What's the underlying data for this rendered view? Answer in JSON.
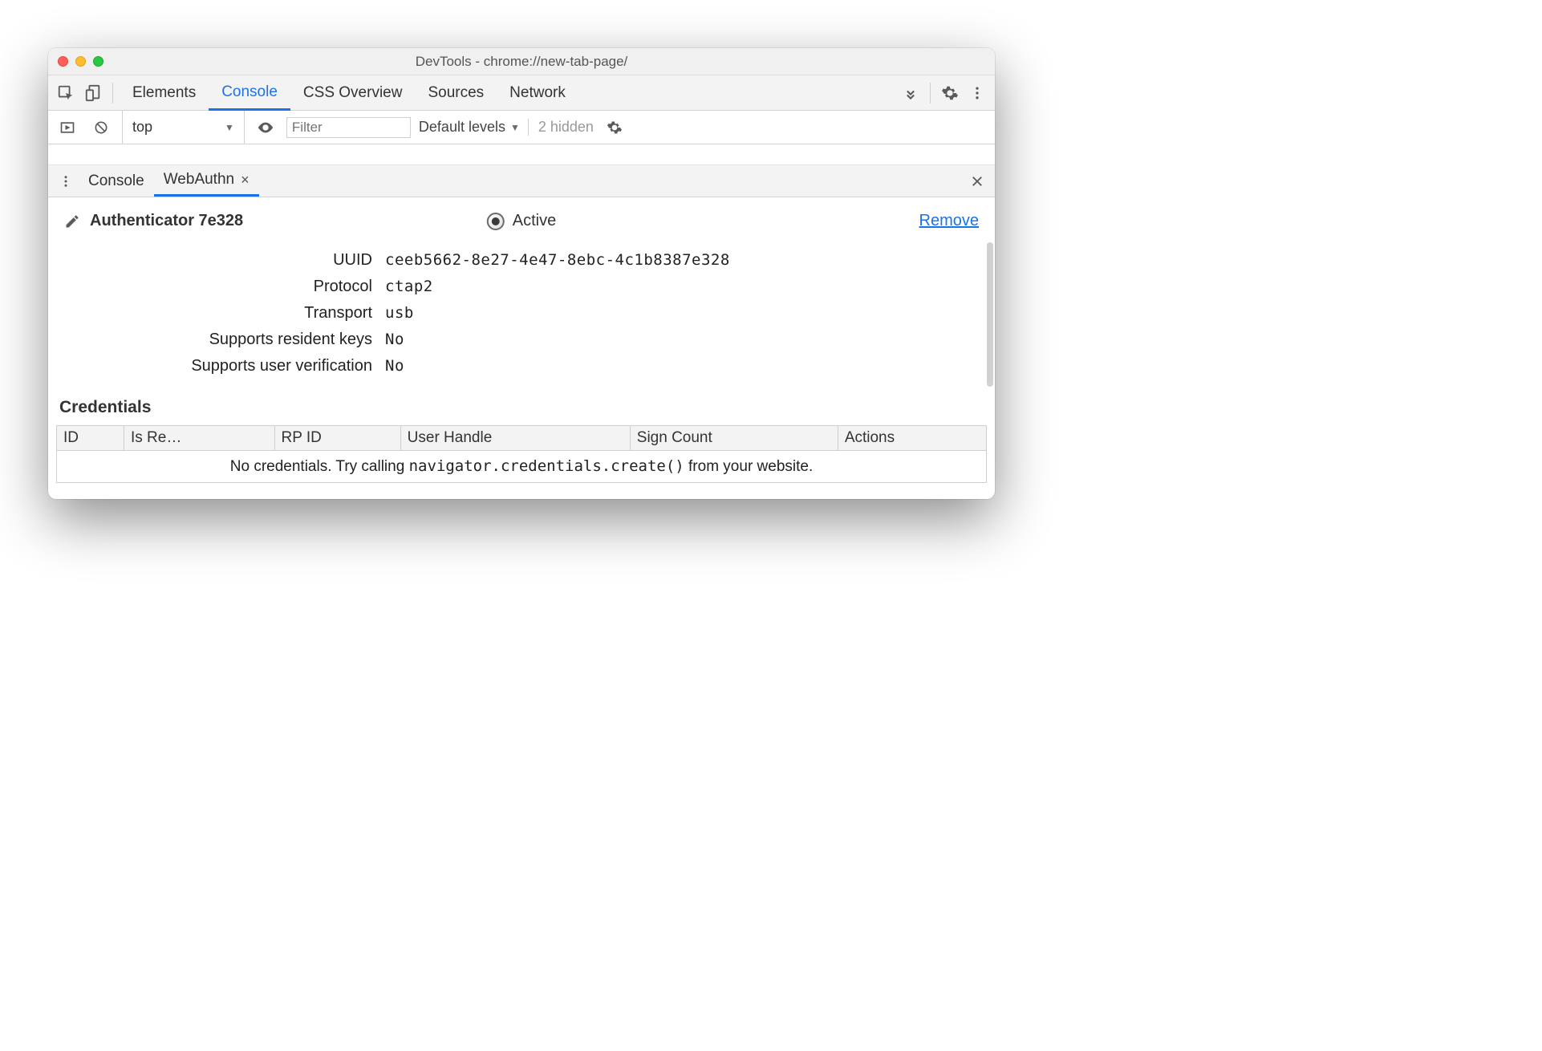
{
  "window": {
    "title": "DevTools - chrome://new-tab-page/"
  },
  "tabs": {
    "items": [
      "Elements",
      "Console",
      "CSS Overview",
      "Sources",
      "Network"
    ],
    "active_index": 1
  },
  "console_toolbar": {
    "context": "top",
    "filter_placeholder": "Filter",
    "levels_label": "Default levels",
    "hidden_label": "2 hidden"
  },
  "drawer": {
    "tabs": [
      {
        "label": "Console",
        "closable": false
      },
      {
        "label": "WebAuthn",
        "closable": true
      }
    ],
    "active_index": 1
  },
  "authenticator": {
    "title": "Authenticator 7e328",
    "active_label": "Active",
    "active": true,
    "remove_label": "Remove",
    "properties": [
      {
        "label": "UUID",
        "value": "ceeb5662-8e27-4e47-8ebc-4c1b8387e328"
      },
      {
        "label": "Protocol",
        "value": "ctap2"
      },
      {
        "label": "Transport",
        "value": "usb"
      },
      {
        "label": "Supports resident keys",
        "value": "No"
      },
      {
        "label": "Supports user verification",
        "value": "No"
      }
    ]
  },
  "credentials": {
    "heading": "Credentials",
    "columns": [
      "ID",
      "Is Re…",
      "RP ID",
      "User Handle",
      "Sign Count",
      "Actions"
    ],
    "empty_prefix": "No credentials. Try calling ",
    "empty_code": "navigator.credentials.create()",
    "empty_suffix": " from your website."
  }
}
